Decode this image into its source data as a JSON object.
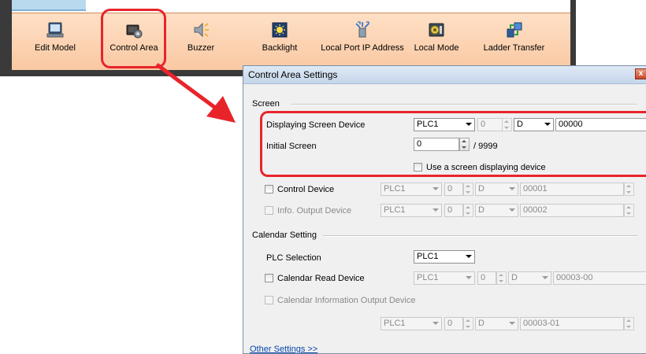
{
  "toolbar": {
    "items": [
      {
        "label": "Edit Model",
        "icon": "edit-model-icon"
      },
      {
        "label": "Control Area",
        "icon": "control-area-icon"
      },
      {
        "label": "Buzzer",
        "icon": "buzzer-icon"
      },
      {
        "label": "Backlight",
        "icon": "backlight-icon"
      },
      {
        "label": "Local Port IP Address",
        "icon": "local-port-ip-icon"
      },
      {
        "label": "Local Mode",
        "icon": "local-mode-icon"
      },
      {
        "label": "Ladder Transfer",
        "icon": "ladder-transfer-icon"
      }
    ]
  },
  "dialog": {
    "title": "Control Area Settings",
    "close": "x",
    "screen_group": "Screen",
    "displaying_label": "Displaying Screen Device",
    "displaying_plc": "PLC1",
    "displaying_station": "0",
    "displaying_dev": "D",
    "displaying_addr": "00000",
    "initial_label": "Initial Screen",
    "initial_value": "0",
    "initial_max": "/ 9999",
    "use_device_label": "Use a screen displaying device",
    "control_label": "Control Device",
    "control_plc": "PLC1",
    "control_station": "0",
    "control_dev": "D",
    "control_addr": "00001",
    "info_label": "Info. Output Device",
    "info_plc": "PLC1",
    "info_station": "0",
    "info_dev": "D",
    "info_addr": "00002",
    "calendar_group": "Calendar Setting",
    "plc_sel_label": "PLC Selection",
    "plc_sel_value": "PLC1",
    "cal_read_label": "Calendar Read Device",
    "cal_read_plc": "PLC1",
    "cal_read_station": "0",
    "cal_read_dev": "D",
    "cal_read_addr": "00003-00",
    "cal_info_label": "Calendar Information Output Device",
    "cal_info_plc": "PLC1",
    "cal_info_station": "0",
    "cal_info_dev": "D",
    "cal_info_addr": "00003-01",
    "other_settings": "Other Settings >>"
  },
  "colors": {
    "highlight": "#e8242b",
    "toolbar_top": "#ffe0c6",
    "toolbar_bottom": "#f9c8a2"
  }
}
